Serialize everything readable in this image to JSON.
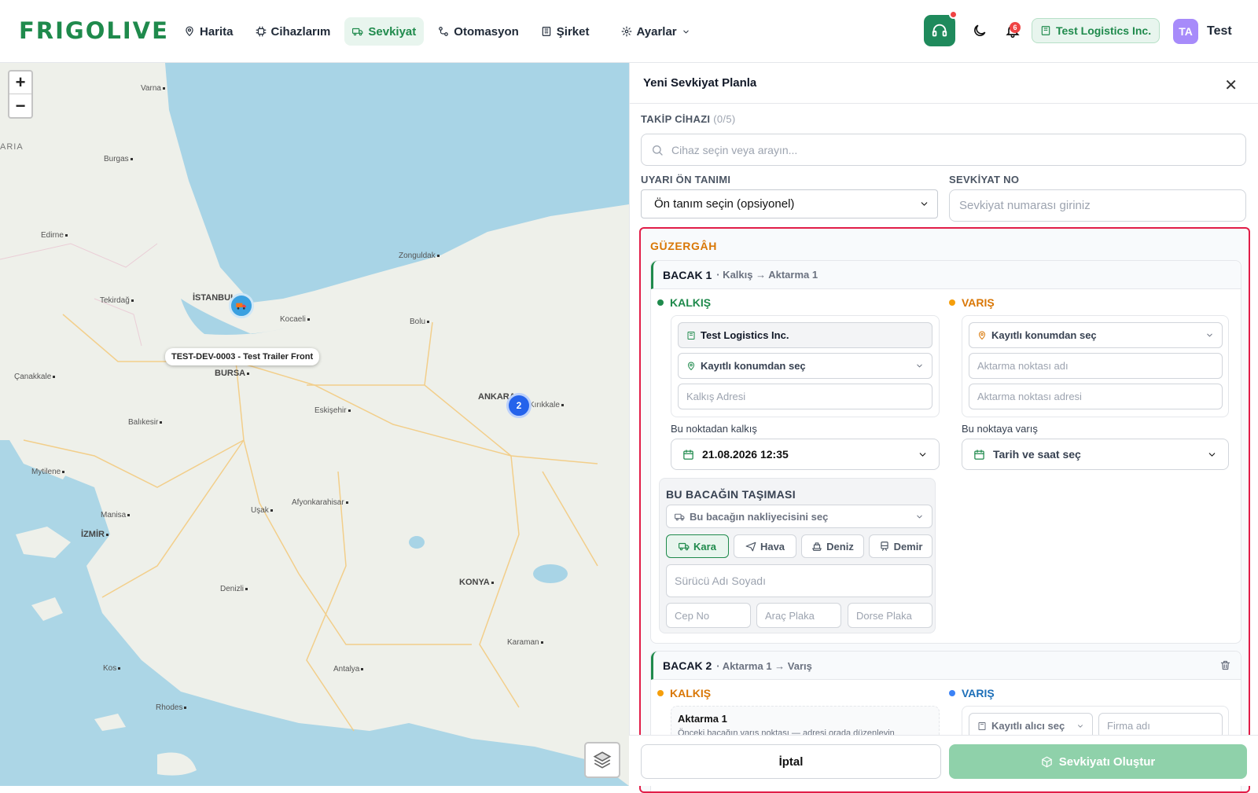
{
  "brand": {
    "logo_text": "FRIGOLIVE",
    "accent": "#1f8a4c"
  },
  "nav": {
    "items": [
      {
        "label": "Harita",
        "icon": "map-pin-icon"
      },
      {
        "label": "Cihazlarım",
        "icon": "chip-icon"
      },
      {
        "label": "Sevkiyat",
        "icon": "truck-icon",
        "active": true
      },
      {
        "label": "Otomasyon",
        "icon": "workflow-icon"
      },
      {
        "label": "Şirket",
        "icon": "building-icon"
      },
      {
        "label": "Ayarlar",
        "icon": "gear-icon"
      }
    ]
  },
  "header": {
    "notification_count": "6",
    "company": "Test Logistics Inc.",
    "avatar_initials": "TA",
    "username": "Test"
  },
  "map": {
    "zoom_in": "+",
    "zoom_out": "−",
    "device_label": "TEST-DEV-0003 - Test Trailer Front",
    "cluster_count": "2",
    "places": [
      "Varna",
      "Burgas",
      "Edirne",
      "Tekirdağ",
      "İSTANBUL",
      "Zonguldak",
      "Kocaeli",
      "Bolu",
      "BURSA",
      "ANKARA",
      "Kırıkkale",
      "Çanakkale",
      "Eskişehir",
      "Balıkesir",
      "Mytilene",
      "Afyonkarahisar",
      "Manisa",
      "Uşak",
      "İZMİR",
      "KONYA",
      "Denizli",
      "Karaman",
      "Kos",
      "Antalya",
      "Rhodes",
      "ARIA"
    ]
  },
  "panel": {
    "title": "Yeni Sevkiyat Planla",
    "device_label": "TAKİP CİHAZI",
    "device_count": "(0/5)",
    "device_placeholder": "Cihaz seçin veya arayın...",
    "alert_label": "UYARI ÖN TANIMI",
    "alert_value": "Ön tanım seçin (opsiyonel)",
    "shipment_no_label": "SEVKİYAT NO",
    "shipment_no_placeholder": "Sevkiyat numarası giriniz"
  },
  "route": {
    "title": "GÜZERGÂH",
    "leg1": {
      "title": "BACAK 1",
      "sub": "· Kalkış → Aktarma 1",
      "departure_label": "KALKIŞ",
      "arrival_label": "VARIŞ",
      "company": "Test Logistics Inc.",
      "saved_location": "Kayıtlı konumdan seç",
      "departure_address_placeholder": "Kalkış Adresi",
      "arrival_saved_location": "Kayıtlı konumdan seç",
      "transfer_name_placeholder": "Aktarma noktası adı",
      "transfer_address_placeholder": "Aktarma noktası adresi",
      "departure_time_label": "Bu noktadan kalkış",
      "departure_time": "21.08.2026 12:35",
      "arrival_time_label": "Bu noktaya varış",
      "arrival_time_placeholder": "Tarih ve saat seç",
      "transport": {
        "title": "BU BACAĞIN TAŞIMASI",
        "carrier_placeholder": "Bu bacağın nakliyecisini seç",
        "modes": [
          "Kara",
          "Hava",
          "Deniz",
          "Demir"
        ],
        "driver_placeholder": "Sürücü Adı Soyadı",
        "phone_placeholder": "Cep No",
        "plate_placeholder": "Araç Plaka",
        "trailer_placeholder": "Dorse Plaka"
      }
    },
    "leg2": {
      "title": "BACAK 2",
      "sub": "· Aktarma 1 → Varış",
      "departure_label": "KALKIŞ",
      "arrival_label": "VARIŞ",
      "transfer_title": "Aktarma 1",
      "transfer_note": "Önceki bacağın varış noktası — adresi orada düzenleyin",
      "receiver_select": "Kayıtlı alıcı seç",
      "company_placeholder": "Firma adı"
    }
  },
  "footer": {
    "cancel": "İptal",
    "submit": "Sevkiyatı Oluştur"
  }
}
